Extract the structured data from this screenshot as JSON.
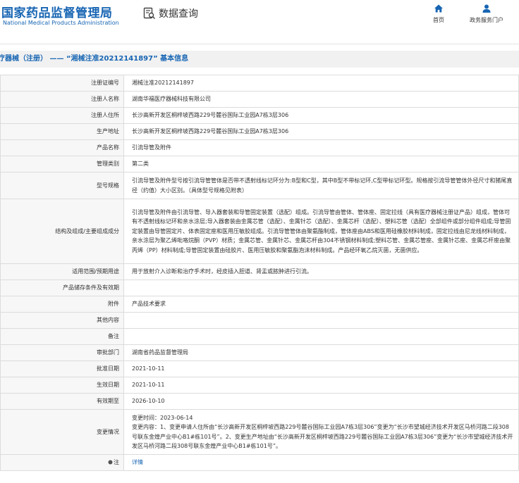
{
  "header": {
    "logo_cn": "国家药品监督管理局",
    "logo_en": "National Medical Products Administration",
    "query_label": "数据查询",
    "nav": [
      {
        "label": "首页",
        "icon": "home-icon"
      },
      {
        "label": "政务服务门户",
        "icon": "user-icon"
      }
    ]
  },
  "page_title": "疗器械（注册） —— “湘械注准20212141897” 基本信息",
  "fields": [
    {
      "label": "注册证编号",
      "value": "湘械注准20212141897"
    },
    {
      "label": "注册人名称",
      "value": "湖南华福医疗器械科技有限公司"
    },
    {
      "label": "注册人住所",
      "value": "长沙高新开发区桐梓坡西路229号麓谷国际工业园A7栋3层306"
    },
    {
      "label": "生产地址",
      "value": "长沙高新开发区桐梓坡西路229号麓谷国际工业园A7栋3层306"
    },
    {
      "label": "产品名称",
      "value": "引流导管及附件"
    },
    {
      "label": "管理类别",
      "value": "第二类"
    },
    {
      "label": "型号规格",
      "value": "引流导管及附件型号按引流导管管体是否带不透射线标记环分为:B型和C型，其中B型不带标记环,C型带标记环型。规格按引流导管管体外径尺寸和猪尾直径（约值）大小区别。（具体型号规格见附表）"
    },
    {
      "label": "结构及组成/主要组成成分",
      "value": "引流导管及附件由引流导管、导入器套装和导管固定装置（选配）组成。引流导管由管体、管体座、固定拉线（具有医疗器械注册证产品）组成，管体可有不透射线标记环和亲水涂层;导入器套装由金属芯管（选配）、金属针芯（选配）、金属芯杆（选配）、塑料芯管（选配）全部组件或部分组件组成;导管固定装置由导管固定片、体表固定座和医用压敏胶组成。引流导管管体由聚氨酯制成，管体座由ABS和医用硅橡胶材料制成，固定拉线由尼龙线材料制成，亲水涂层为聚乙烯吡咯烷酮（PVP）材质；金属芯管、金属针芯、金属芯杆由304不锈钢材料制成;塑料芯管、金属芯管座、金属针芯座、金属芯杆座由聚丙烯（PP）材料制成;导管固定装置由硅胶片、医用压敏胶和聚氨酯泡沫材料制成。产品经环氧乙烷灭菌，无菌供应。"
    },
    {
      "label": "适用范围/预期用途",
      "value": "用于放射介入诊断和治疗手术时，经皮插入胆道、肾盂或脓肿进行引流。"
    },
    {
      "label": "产品储存条件及有效期",
      "value": ""
    },
    {
      "label": "附件",
      "value": "产品技术要求"
    },
    {
      "label": "其他内容",
      "value": ""
    },
    {
      "label": "备注",
      "value": ""
    },
    {
      "label": "审批部门",
      "value": "湖南省药品监督管理局"
    },
    {
      "label": "批准日期",
      "value": "2021-10-11"
    },
    {
      "label": "生效日期",
      "value": "2021-10-11"
    },
    {
      "label": "有效期至",
      "value": "2026-10-10"
    },
    {
      "label": "变更情况",
      "value": "变更时间：2023-06-14\n变更内容：1、变更申请人住所由“长沙高新开发区桐梓坡西路229号麓谷国际工业园A7栋3层306”变更为“长沙市望城经济技术开发区马桥河路二段308号联东金煌产业中心B1#栋101号”。2、变更生产地址由“长沙高新开发区桐梓坡西路229号麓谷国际工业园A7栋3层306”变更为“长沙市望城经济技术开发区马桥河路二段308号联东金煌产业中心B1#栋101号”。"
    },
    {
      "label": "注",
      "value": "详情"
    }
  ]
}
